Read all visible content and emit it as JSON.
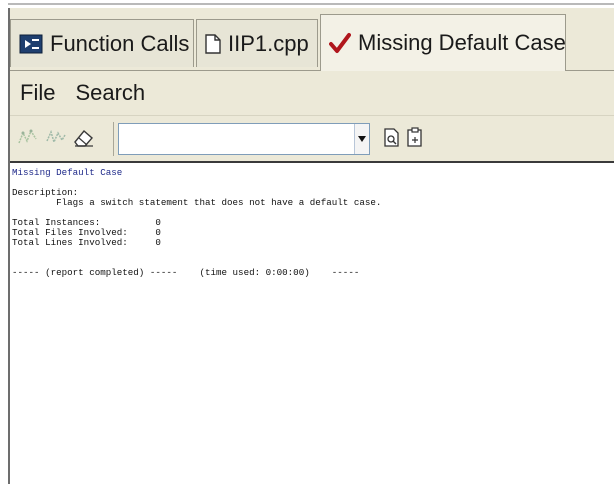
{
  "tabs": [
    {
      "label": "Function Calls",
      "icon": "function-calls-icon",
      "active": false
    },
    {
      "label": "IIP1.cpp",
      "icon": "document-icon",
      "active": false
    },
    {
      "label": "Missing Default Case",
      "icon": "checkmark-icon",
      "active": true
    }
  ],
  "menu": {
    "file": "File",
    "search": "Search"
  },
  "toolbar": {
    "combo_value": ""
  },
  "report": {
    "title": "Missing Default Case",
    "description_label": "Description:",
    "description": "        Flags a switch statement that does not have a default case.",
    "instances": "Total Instances:          0",
    "files": "Total Files Involved:     0",
    "lines": "Total Lines Involved:     0",
    "footer": "----- (report completed) -----    (time used: 0:00:00)    -----"
  },
  "colors": {
    "accent_check": "#b0161c",
    "title_text": "#1f2a8a"
  }
}
